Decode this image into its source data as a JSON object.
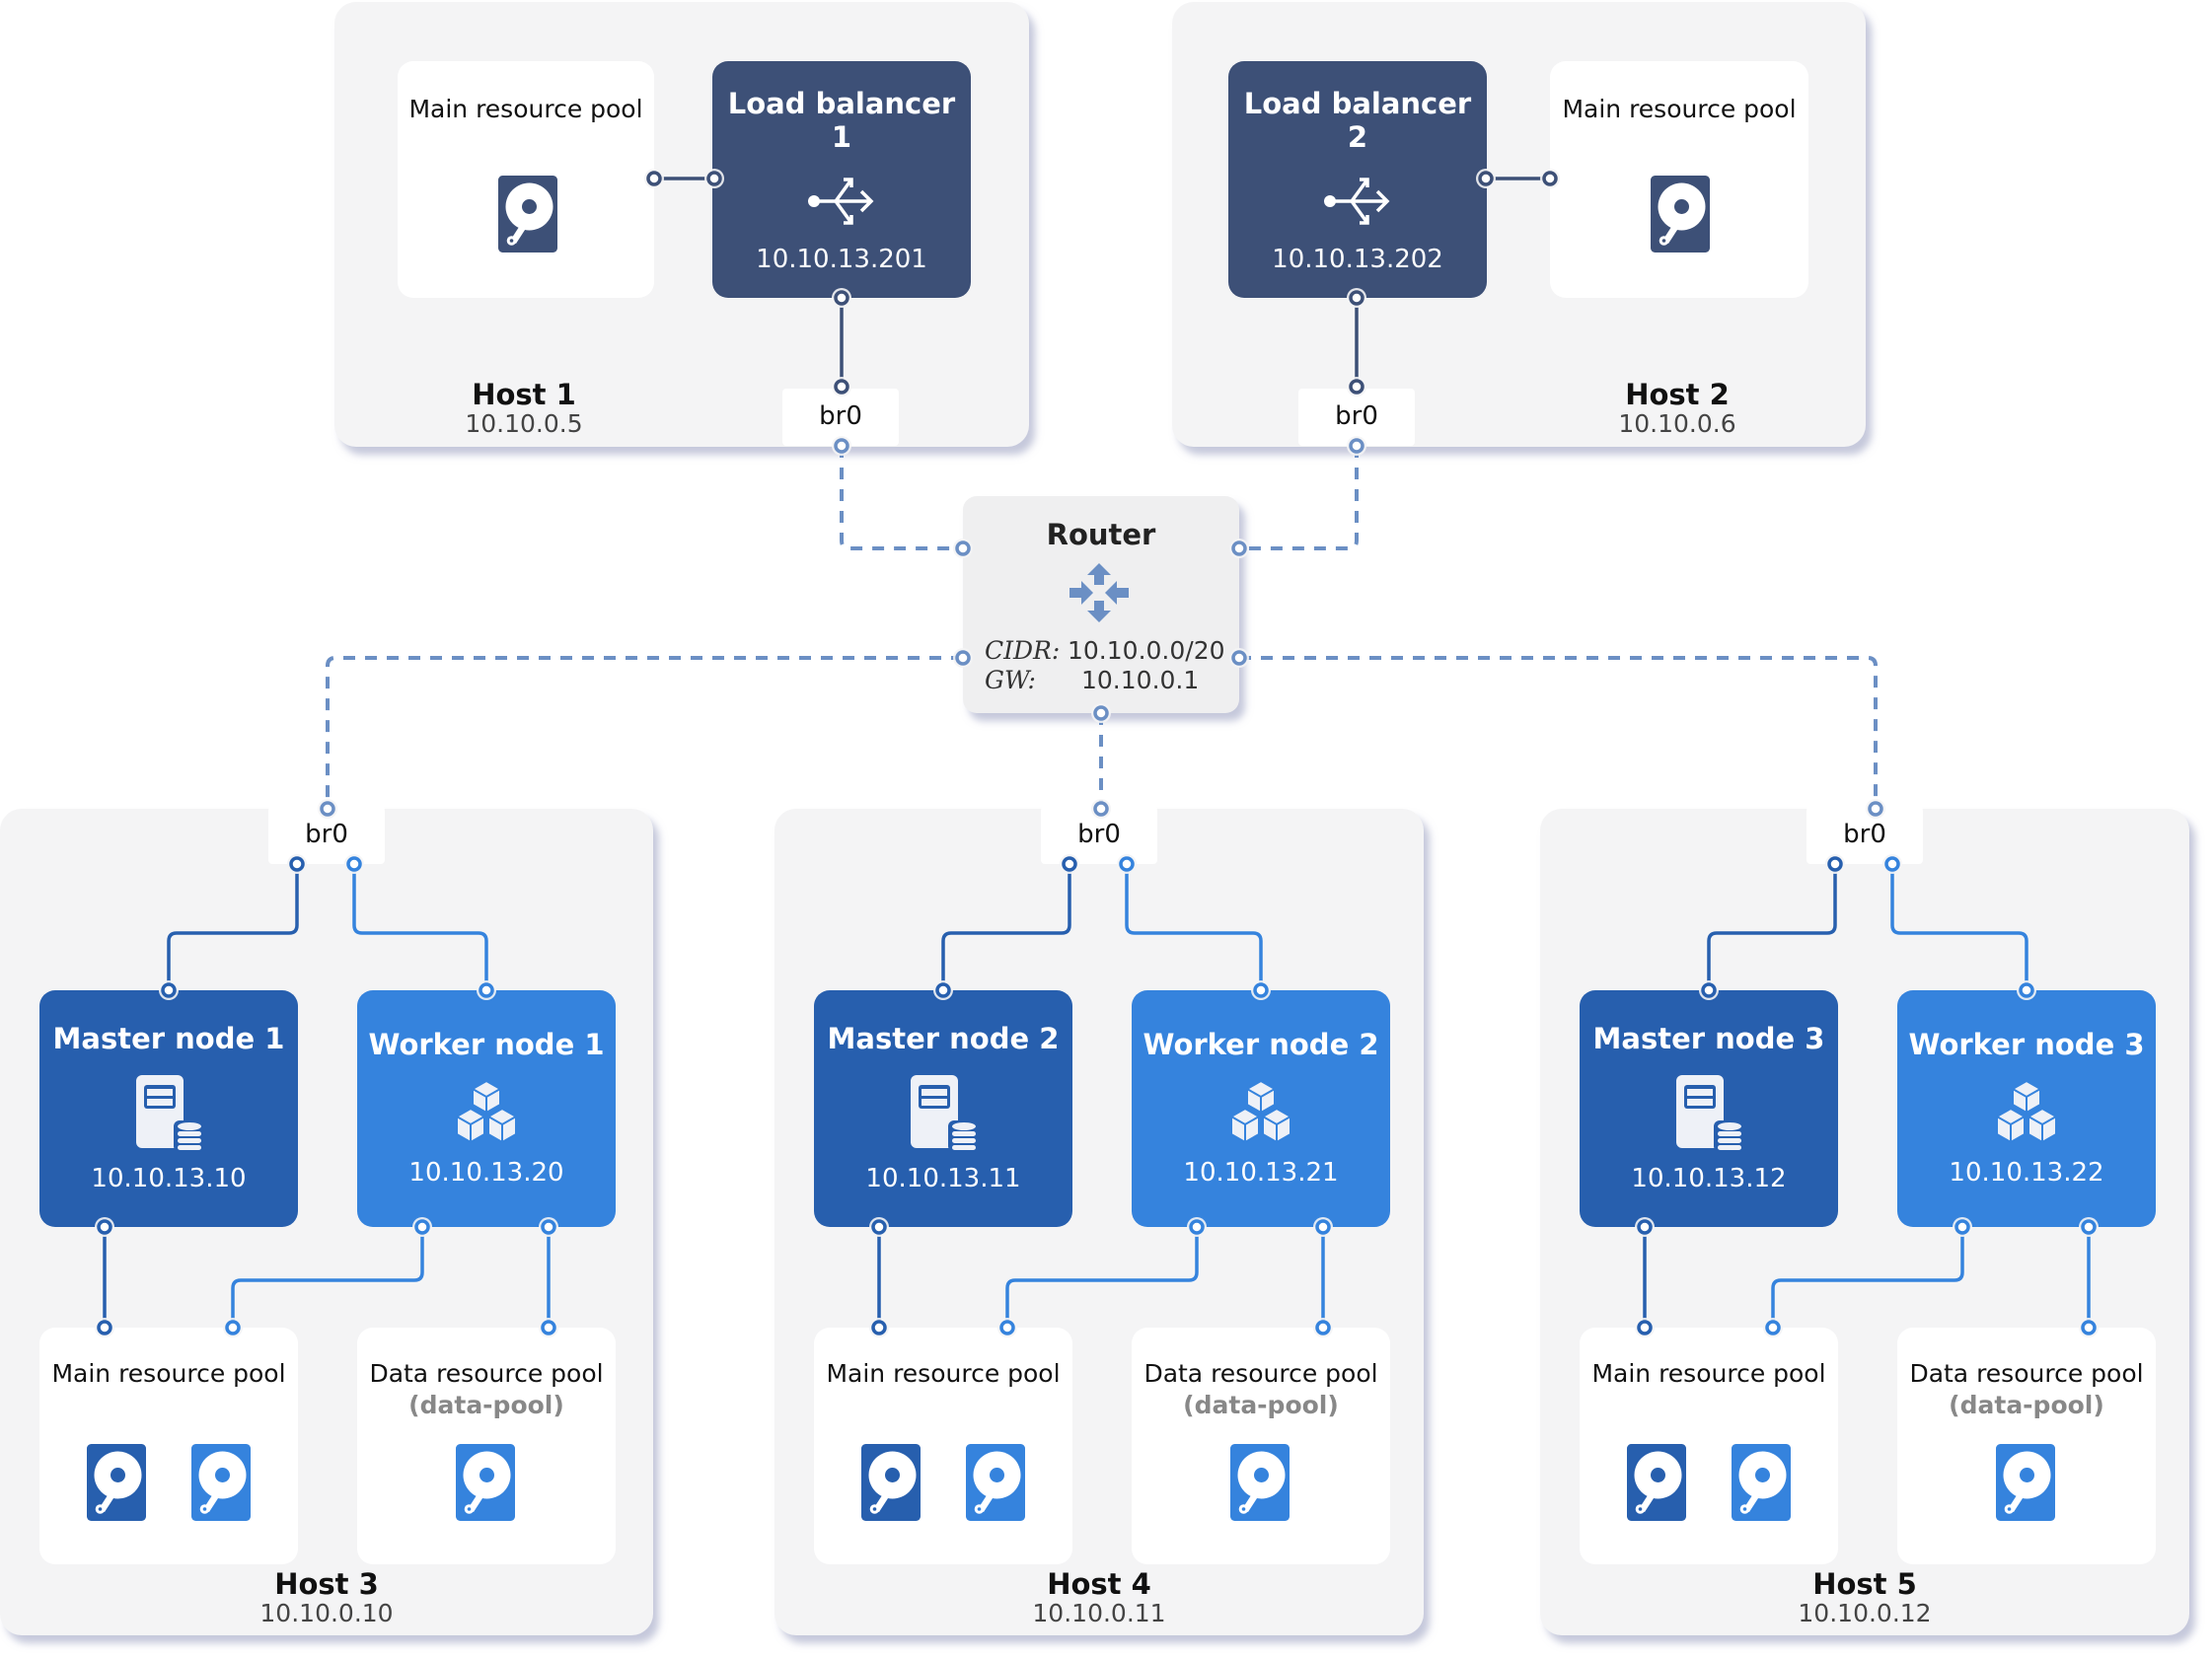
{
  "colors": {
    "host_bg": "#f4f4f5",
    "load_balancer": "#3d5077",
    "master_node": "#275fae",
    "worker_node": "#3583dd",
    "router_link": "#6b8fc4",
    "bridge_bg": "#ffffff"
  },
  "hosts": [
    {
      "name": "Host 1",
      "ip": "10.10.0.5",
      "bridge": "br0",
      "pool": {
        "label": "Main resource pool",
        "icon": "hard-disk-icon"
      },
      "load_balancer": {
        "label": "Load balancer",
        "number": "1",
        "ip": "10.10.13.201",
        "icon": "load-balancer-icon"
      }
    },
    {
      "name": "Host 2",
      "ip": "10.10.0.6",
      "bridge": "br0",
      "pool": {
        "label": "Main resource pool",
        "icon": "hard-disk-icon"
      },
      "load_balancer": {
        "label": "Load balancer",
        "number": "2",
        "ip": "10.10.13.202",
        "icon": "load-balancer-icon"
      }
    },
    {
      "name": "Host 3",
      "ip": "10.10.0.10",
      "bridge": "br0",
      "master": {
        "label": "Master node 1",
        "ip": "10.10.13.10",
        "icon": "server-database-icon"
      },
      "worker": {
        "label": "Worker node 1",
        "ip": "10.10.13.20",
        "icon": "cubes-icon"
      },
      "main_pool": {
        "label": "Main resource pool",
        "disks": 2
      },
      "data_pool": {
        "label": "Data resource pool",
        "sublabel": "(data-pool)",
        "disks": 1
      }
    },
    {
      "name": "Host 4",
      "ip": "10.10.0.11",
      "bridge": "br0",
      "master": {
        "label": "Master node 2",
        "ip": "10.10.13.11",
        "icon": "server-database-icon"
      },
      "worker": {
        "label": "Worker node 2",
        "ip": "10.10.13.21",
        "icon": "cubes-icon"
      },
      "main_pool": {
        "label": "Main resource pool",
        "disks": 2
      },
      "data_pool": {
        "label": "Data resource pool",
        "sublabel": "(data-pool)",
        "disks": 1
      }
    },
    {
      "name": "Host 5",
      "ip": "10.10.0.12",
      "bridge": "br0",
      "master": {
        "label": "Master node 3",
        "ip": "10.10.13.12",
        "icon": "server-database-icon"
      },
      "worker": {
        "label": "Worker node 3",
        "ip": "10.10.13.22",
        "icon": "cubes-icon"
      },
      "main_pool": {
        "label": "Main resource pool",
        "disks": 2
      },
      "data_pool": {
        "label": "Data resource pool",
        "sublabel": "(data-pool)",
        "disks": 1
      }
    }
  ],
  "router": {
    "title": "Router",
    "icon": "router-arrows-icon",
    "cidr_label": "CIDR:",
    "cidr": "10.10.0.0/20",
    "gw_label": "GW:",
    "gw": "10.10.0.1"
  }
}
